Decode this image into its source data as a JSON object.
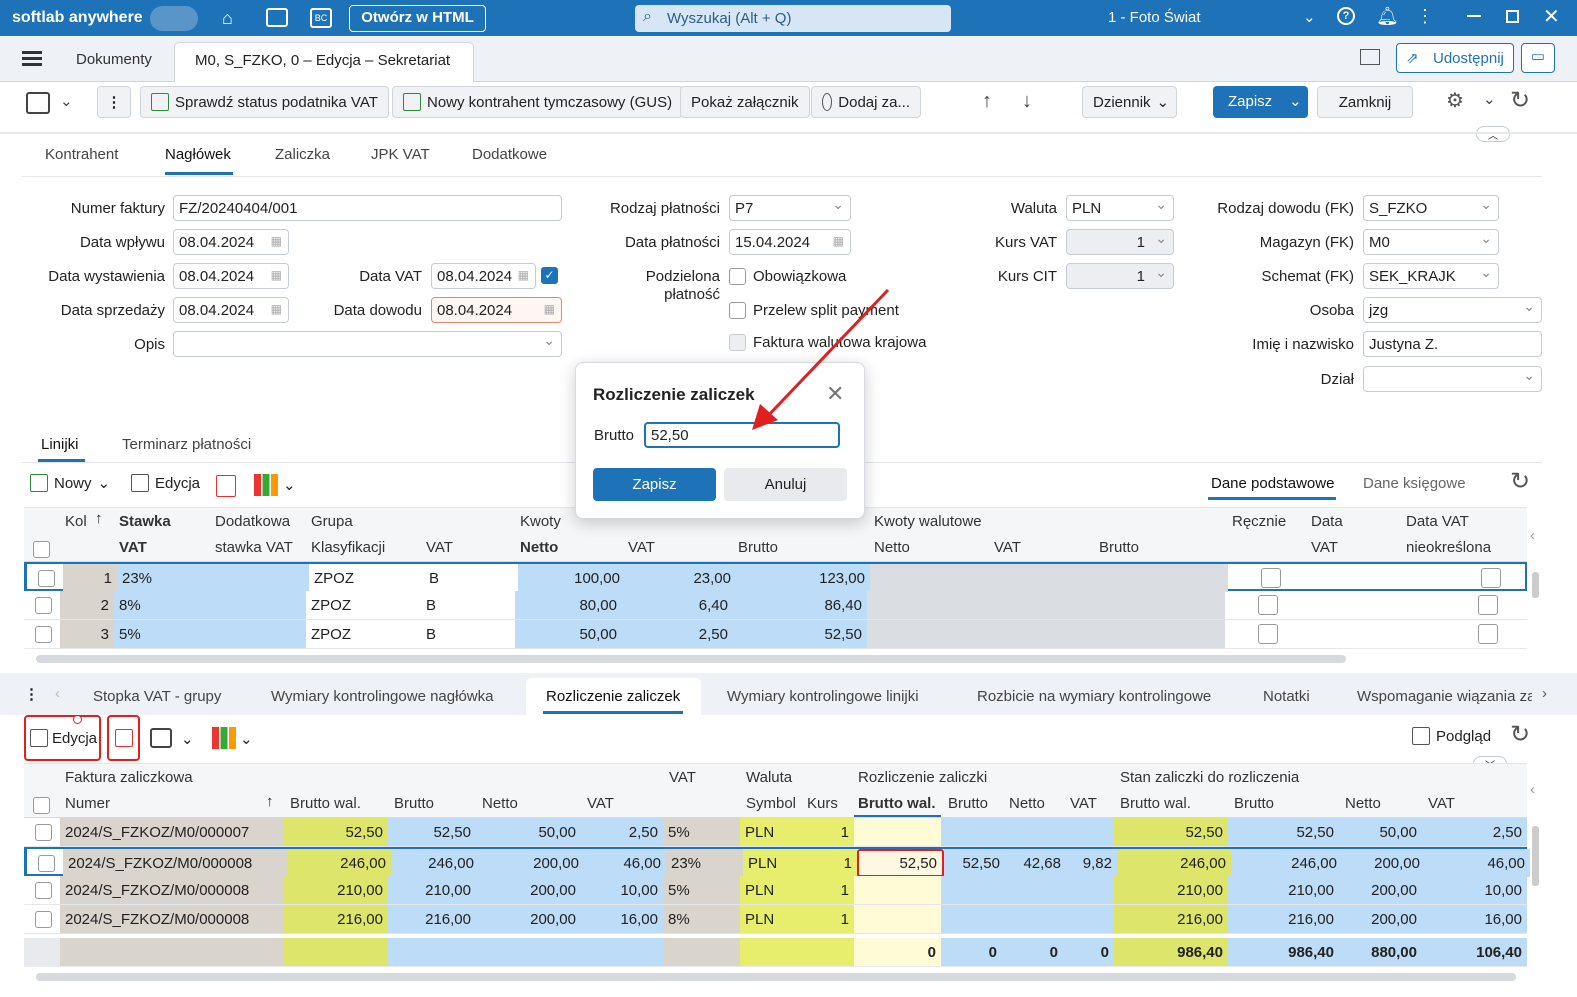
{
  "titlebar": {
    "app": "softlab anywhere",
    "open_html": "Otwórz w HTML",
    "search_placeholder": "Wyszukaj (Alt + Q)",
    "company": "1 - Foto Świat"
  },
  "doc_tabs": {
    "documents": "Dokumenty",
    "current": "M0, S_FZKO, 0 – Edycja – Sekretariat",
    "share": "Udostępnij"
  },
  "toolbar": {
    "check_vat": "Sprawdź status podatnika VAT",
    "new_contractor": "Nowy kontrahent tymczasowy (GUS)",
    "show_attachment": "Pokaż załącznik",
    "add_attachment": "Dodaj za...",
    "journal": "Dziennik",
    "save": "Zapisz",
    "close": "Zamknij"
  },
  "form_tabs": [
    "Kontrahent",
    "Nagłówek",
    "Zaliczka",
    "JPK VAT",
    "Dodatkowe"
  ],
  "form": {
    "invoice_no_label": "Numer faktury",
    "invoice_no": "FZ/20240404/001",
    "receipt_date_label": "Data wpływu",
    "receipt_date": "08.04.2024",
    "issue_date_label": "Data wystawienia",
    "issue_date": "08.04.2024",
    "vat_date_label": "Data VAT",
    "vat_date": "08.04.2024",
    "sale_date_label": "Data sprzedaży",
    "sale_date": "08.04.2024",
    "proof_date_label": "Data dowodu",
    "proof_date": "08.04.2024",
    "desc_label": "Opis",
    "payment_type_label": "Rodzaj płatności",
    "payment_type": "P7",
    "payment_date_label": "Data płatności",
    "payment_date": "15.04.2024",
    "split_label_1": "Podzielona",
    "split_label_2": "płatność",
    "mandatory": "Obowiązkowa",
    "split_transfer": "Przelew split payment",
    "foreign_invoice": "Faktura walutowa krajowa",
    "currency_label": "Waluta",
    "currency": "PLN",
    "rate_vat_label": "Kurs VAT",
    "rate_vat": "1",
    "rate_cit_label": "Kurs CIT",
    "rate_cit": "1",
    "proof_type_label": "Rodzaj dowodu (FK)",
    "proof_type": "S_FZKO",
    "warehouse_label": "Magazyn (FK)",
    "warehouse": "M0",
    "scheme_label": "Schemat (FK)",
    "scheme": "SEK_KRAJK",
    "person_label": "Osoba",
    "person": "jzg",
    "name_label": "Imię i nazwisko",
    "name": "Justyna  Z.",
    "dept_label": "Dział"
  },
  "dialog": {
    "title": "Rozliczenie zaliczek",
    "brutto_label": "Brutto",
    "brutto": "52,50",
    "save": "Zapisz",
    "cancel": "Anuluj"
  },
  "lines": {
    "tabs": [
      "Linijki",
      "Terminarz płatności"
    ],
    "new": "Nowy",
    "edit": "Edycja",
    "basic": "Dane podstawowe",
    "accounting": "Dane księgowe",
    "headers": {
      "kol": "Kol",
      "stawka": "Stawka",
      "vat": "VAT",
      "dodatkowa": "Dodatkowa",
      "stawka_vat": "stawka VAT",
      "grupa": "Grupa",
      "klasyfikacji": "Klasyfikacji",
      "gvat": "VAT",
      "kwoty": "Kwoty",
      "netto": "Netto",
      "kvat": "VAT",
      "brutto": "Brutto",
      "kwoty_wal": "Kwoty walutowe",
      "wnetto": "Netto",
      "wvat": "VAT",
      "wbrutto": "Brutto",
      "recznie": "Ręcznie",
      "data": "Data",
      "dvat": "VAT",
      "data_vat": "Data VAT",
      "nieokreslona": "nieokreślona"
    },
    "rows": [
      {
        "no": "1",
        "rate": "23%",
        "group": "ZPOZ",
        "vat": "B",
        "net": "100,00",
        "tax": "23,00",
        "gross": "123,00"
      },
      {
        "no": "2",
        "rate": "8%",
        "group": "ZPOZ",
        "vat": "B",
        "net": "80,00",
        "tax": "6,40",
        "gross": "86,40"
      },
      {
        "no": "3",
        "rate": "5%",
        "group": "ZPOZ",
        "vat": "B",
        "net": "50,00",
        "tax": "2,50",
        "gross": "52,50"
      }
    ]
  },
  "bottom_tabs": [
    "Stopka VAT - grupy",
    "Wymiary kontrolingowe nagłówka",
    "Rozliczenie zaliczek",
    "Wymiary kontrolingowe linijki",
    "Rozbicie na wymiary kontrolingowe",
    "Notatki",
    "Wspomaganie wiązania za"
  ],
  "adv": {
    "edit": "Edycja",
    "preview": "Podgląd",
    "headers": {
      "faktura": "Faktura zaliczkowa",
      "numer": "Numer",
      "brutto_wal": "Brutto wal.",
      "brutto": "Brutto",
      "netto": "Netto",
      "vat": "VAT",
      "vat_rate": "VAT",
      "waluta": "Waluta",
      "symbol": "Symbol",
      "kurs": "Kurs",
      "rozl": "Rozliczenie zaliczki",
      "r_brutto_wal": "Brutto wal.",
      "r_brutto": "Brutto",
      "r_netto": "Netto",
      "r_vat": "VAT",
      "stan": "Stan zaliczki do rozliczenia",
      "s_brutto_wal": "Brutto wal.",
      "s_brutto": "Brutto",
      "s_netto": "Netto",
      "s_vat": "VAT"
    },
    "rows": [
      {
        "num": "2024/S_FZKOZ/M0/000007",
        "bw": "52,50",
        "b": "52,50",
        "n": "50,00",
        "v": "2,50",
        "rate": "5%",
        "sym": "PLN",
        "kurs": "1",
        "rbw": "",
        "rb": "",
        "rn": "",
        "rv": "",
        "sbw": "52,50",
        "sb": "52,50",
        "sn": "50,00",
        "sv": "2,50"
      },
      {
        "num": "2024/S_FZKOZ/M0/000008",
        "bw": "246,00",
        "b": "246,00",
        "n": "200,00",
        "v": "46,00",
        "rate": "23%",
        "sym": "PLN",
        "kurs": "1",
        "rbw": "52,50",
        "rb": "52,50",
        "rn": "42,68",
        "rv": "9,82",
        "sbw": "246,00",
        "sb": "246,00",
        "sn": "200,00",
        "sv": "46,00"
      },
      {
        "num": "2024/S_FZKOZ/M0/000008",
        "bw": "210,00",
        "b": "210,00",
        "n": "200,00",
        "v": "10,00",
        "rate": "5%",
        "sym": "PLN",
        "kurs": "1",
        "rbw": "",
        "rb": "",
        "rn": "",
        "rv": "",
        "sbw": "210,00",
        "sb": "210,00",
        "sn": "200,00",
        "sv": "10,00"
      },
      {
        "num": "2024/S_FZKOZ/M0/000008",
        "bw": "216,00",
        "b": "216,00",
        "n": "200,00",
        "v": "16,00",
        "rate": "8%",
        "sym": "PLN",
        "kurs": "1",
        "rbw": "",
        "rb": "",
        "rn": "",
        "rv": "",
        "sbw": "216,00",
        "sb": "216,00",
        "sn": "200,00",
        "sv": "16,00"
      }
    ],
    "totals": {
      "rbw": "0",
      "rb": "0",
      "rn": "0",
      "rv": "0",
      "sbw": "986,40",
      "sb": "986,40",
      "sn": "880,00",
      "sv": "106,40"
    }
  }
}
